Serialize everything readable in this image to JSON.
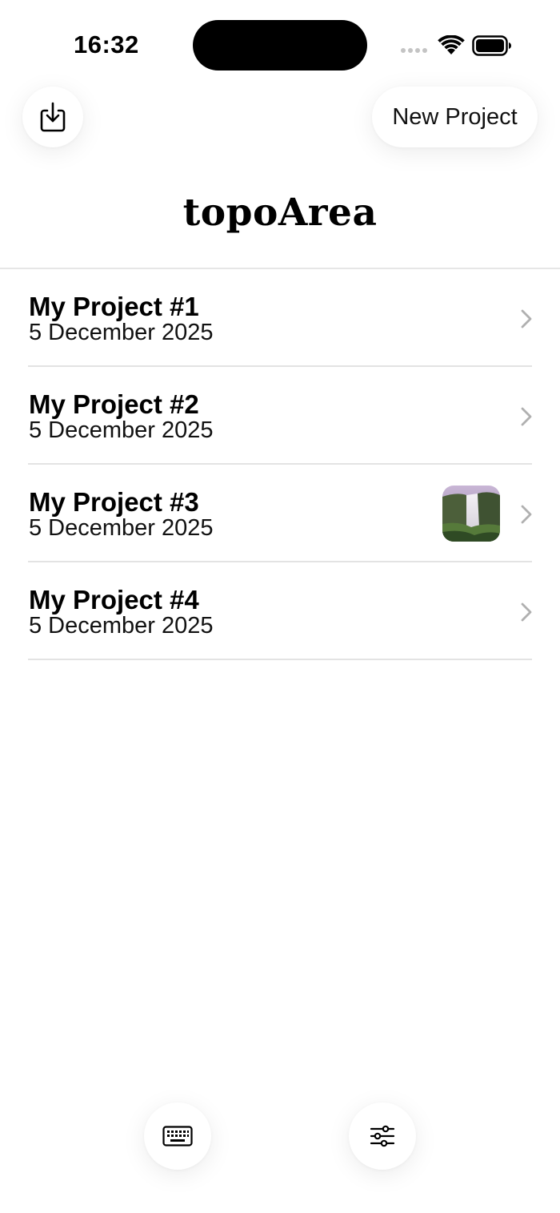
{
  "status_bar": {
    "time": "16:32"
  },
  "toolbar": {
    "import_icon": "tray-download-icon",
    "new_project_label": "New Project"
  },
  "app": {
    "title": "topoArea"
  },
  "projects": [
    {
      "title": "My Project #1",
      "date": "5 December 2025",
      "has_thumbnail": false
    },
    {
      "title": "My Project #2",
      "date": "5 December 2025",
      "has_thumbnail": false
    },
    {
      "title": "My Project #3",
      "date": "5 December 2025",
      "has_thumbnail": true
    },
    {
      "title": "My Project #4",
      "date": "5 December 2025",
      "has_thumbnail": false
    }
  ],
  "bottom_bar": {
    "left_icon": "keyboard-icon",
    "right_icon": "sliders-icon"
  },
  "colors": {
    "background": "#ffffff",
    "divider": "#e3e3e3",
    "chevron": "#b0b0b0",
    "text": "#000000"
  }
}
